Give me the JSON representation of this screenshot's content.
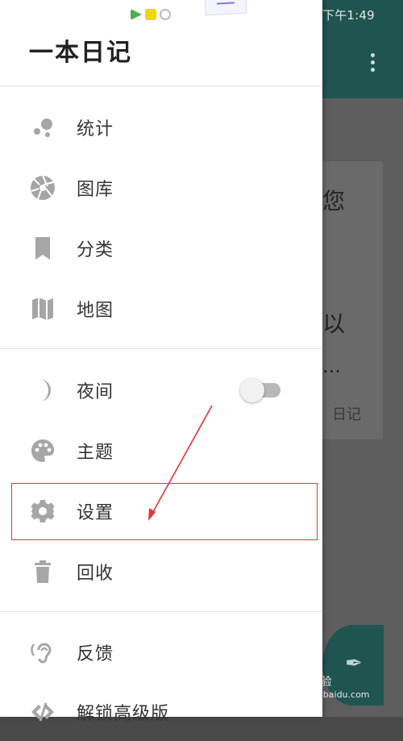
{
  "background": {
    "status_time": "下午1:49",
    "card_text_1": "您",
    "card_text_2": "以",
    "card_text_3": "...",
    "card_tag": "日记",
    "watermark": "Bai 经验",
    "watermark_sub": "jingyan.baidu.com"
  },
  "drawer": {
    "title": "一本日记",
    "items": [
      {
        "label": "统计",
        "icon": "stats-icon"
      },
      {
        "label": "图库",
        "icon": "aperture-icon"
      },
      {
        "label": "分类",
        "icon": "bookmark-icon"
      },
      {
        "label": "地图",
        "icon": "map-icon"
      },
      {
        "label": "夜间",
        "icon": "moon-icon",
        "toggle": "off"
      },
      {
        "label": "主题",
        "icon": "palette-icon"
      },
      {
        "label": "设置",
        "icon": "gear-icon"
      },
      {
        "label": "回收",
        "icon": "trash-icon"
      },
      {
        "label": "反馈",
        "icon": "ear-icon"
      },
      {
        "label": "解锁高级版",
        "icon": "unlock-icon"
      }
    ]
  },
  "colors": {
    "drawer_bg": "#ffffff",
    "icon_gray": "#a6a6a6",
    "highlight": "#e5343a",
    "appbar": "#1f5450"
  }
}
